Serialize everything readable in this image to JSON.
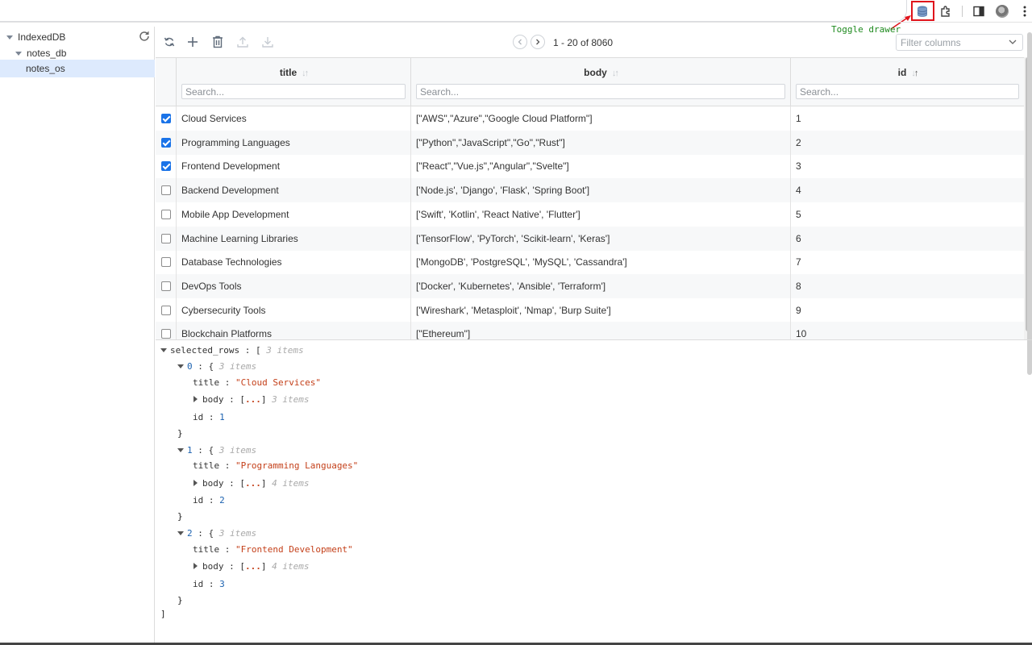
{
  "browser": {
    "annotation": "Toggle drawer"
  },
  "tree": {
    "root_label": "IndexedDB",
    "db_label": "notes_db",
    "store_label": "notes_os"
  },
  "toolbar": {
    "page_text": "1 - 20 of 8060",
    "filter_placeholder": "Filter columns"
  },
  "grid": {
    "columns": [
      {
        "label": "title",
        "placeholder": "Search..."
      },
      {
        "label": "body",
        "placeholder": "Search..."
      },
      {
        "label": "id",
        "placeholder": "Search..."
      }
    ],
    "rows": [
      {
        "checked": true,
        "title": "Cloud Services",
        "body": "[\"AWS\",\"Azure\",\"Google Cloud Platform\"]",
        "id": "1"
      },
      {
        "checked": true,
        "title": "Programming Languages",
        "body": "[\"Python\",\"JavaScript\",\"Go\",\"Rust\"]",
        "id": "2"
      },
      {
        "checked": true,
        "title": "Frontend Development",
        "body": "[\"React\",\"Vue.js\",\"Angular\",\"Svelte\"]",
        "id": "3"
      },
      {
        "checked": false,
        "title": "Backend Development",
        "body": "['Node.js', 'Django', 'Flask', 'Spring Boot']",
        "id": "4"
      },
      {
        "checked": false,
        "title": "Mobile App Development",
        "body": "['Swift', 'Kotlin', 'React Native', 'Flutter']",
        "id": "5"
      },
      {
        "checked": false,
        "title": "Machine Learning Libraries",
        "body": "['TensorFlow', 'PyTorch', 'Scikit-learn', 'Keras']",
        "id": "6"
      },
      {
        "checked": false,
        "title": "Database Technologies",
        "body": "['MongoDB', 'PostgreSQL', 'MySQL', 'Cassandra']",
        "id": "7"
      },
      {
        "checked": false,
        "title": "DevOps Tools",
        "body": "['Docker', 'Kubernetes', 'Ansible', 'Terraform']",
        "id": "8"
      },
      {
        "checked": false,
        "title": "Cybersecurity Tools",
        "body": "['Wireshark', 'Metasploit', 'Nmap', 'Burp Suite']",
        "id": "9"
      },
      {
        "checked": false,
        "title": "Blockchain Platforms",
        "body": "[\"Ethereum\"]",
        "id": "10"
      }
    ]
  },
  "json_view": {
    "root_key": "selected_rows",
    "root_count": "3 items",
    "items": [
      {
        "index": "0",
        "count": "3 items",
        "title": "\"Cloud Services\"",
        "body_count": "3 items",
        "id": "1"
      },
      {
        "index": "1",
        "count": "3 items",
        "title": "\"Programming Languages\"",
        "body_count": "4 items",
        "id": "2"
      },
      {
        "index": "2",
        "count": "3 items",
        "title": "\"Frontend Development\"",
        "body_count": "4 items",
        "id": "3"
      }
    ]
  },
  "colors": {
    "accent": "#1a73e8",
    "highlight": "#e0141c",
    "annotation": "#1e8a1e",
    "string": "#c4401a",
    "number": "#1c62b0"
  }
}
